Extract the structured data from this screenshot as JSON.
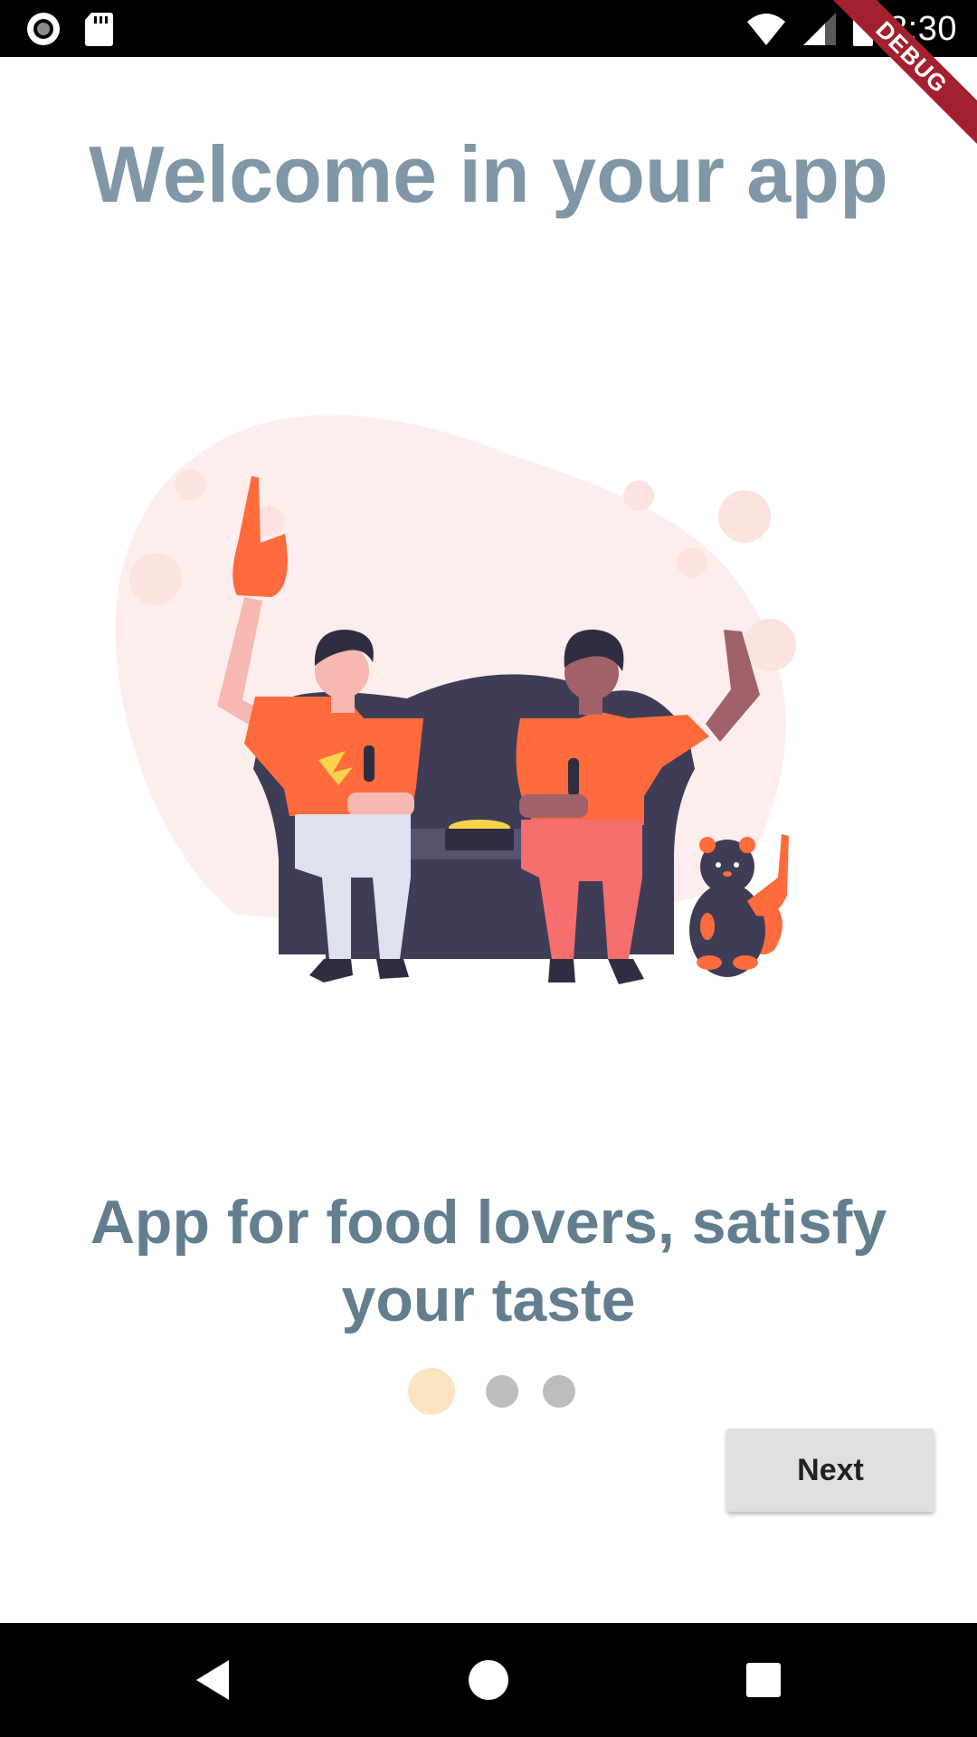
{
  "status_bar": {
    "time": "8:30",
    "icons": [
      "record-icon",
      "sd-card-icon",
      "wifi-icon",
      "signal-icon",
      "battery-icon"
    ]
  },
  "debug_banner": "DEBUG",
  "onboarding": {
    "title": "Welcome in your app",
    "illustration": "friends-watching-game-on-couch-illustration",
    "description": "App for food lovers, satisfy your taste",
    "page_indicator": {
      "current": 1,
      "total": 3
    },
    "next_label": "Next"
  },
  "navigation_bar": {
    "icons": [
      "back-icon",
      "home-icon",
      "recents-icon"
    ]
  },
  "colors": {
    "title": "#7f97a6",
    "description": "#627e8f",
    "active_dot": "#fde4c1",
    "inactive_dot": "#bdbdbd",
    "accent_orange": "#ff6b3d",
    "couch": "#3f3d56",
    "blob": "#fdeeed"
  }
}
